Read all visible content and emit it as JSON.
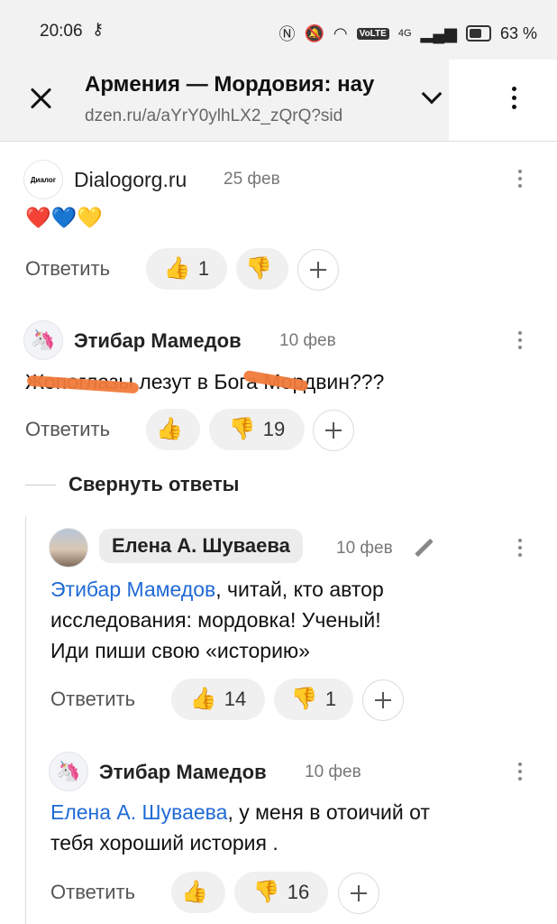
{
  "status": {
    "time": "20:06",
    "volte": "VoLTE",
    "net": "4G",
    "battery": "63 %"
  },
  "header": {
    "title": "Армения — Мордовия: нау",
    "url": "dzen.ru/a/aYrY0ylhLX2_zQrQ?sid"
  },
  "icons": {
    "close": "close-icon",
    "dropdown": "chevron-down-icon",
    "menu": "more-vertical-icon",
    "like": "👍",
    "dislike": "👎",
    "add": "plus-icon",
    "edit": "pencil-icon"
  },
  "comments": [
    {
      "author": "Dialogorg.ru",
      "avatar": "Диалог",
      "date": "25 фев",
      "text": "❤️💙💛",
      "reply": "Ответить",
      "likes": "1",
      "dislikes": ""
    },
    {
      "author": "Этибар Мамедов",
      "avatar": "🦄",
      "date": "10 фев",
      "text": "Жопоглазы лезут в Бога Мордвин???",
      "reply": "Ответить",
      "likes": "",
      "dislikes": "19"
    }
  ],
  "collapse_label": "Свернуть ответы",
  "replies": [
    {
      "author": "Елена А. Шуваева",
      "date": "10 фев",
      "mention": "Этибар Мамедов",
      "text_l1": ", читай, кто автор",
      "text_l2": "исследования: мордовка! Ученый!",
      "text_l3": "Иди пиши свою «историю»",
      "reply": "Ответить",
      "likes": "14",
      "dislikes": "1"
    },
    {
      "author": "Этибар Мамедов",
      "avatar": "🦄",
      "date": "10 фев",
      "mention": "Елена А. Шуваева",
      "text_l1": ", у меня в отоичий от",
      "text_l2": "тебя хороший история .",
      "reply": "Ответить",
      "likes": "",
      "dislikes": "16"
    }
  ]
}
